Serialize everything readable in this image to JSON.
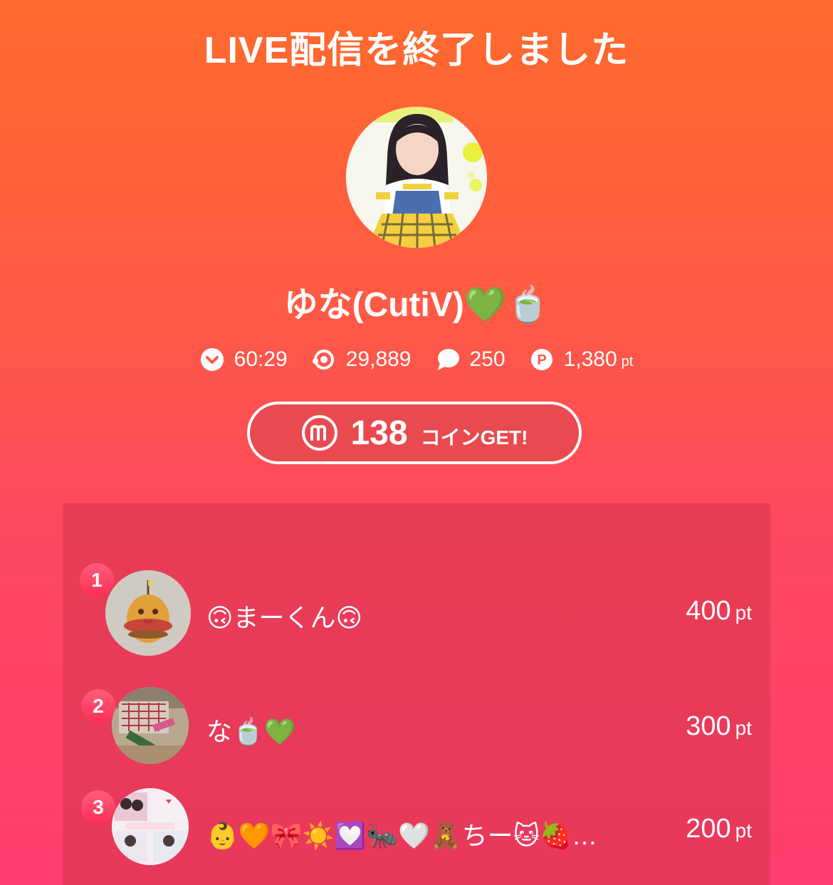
{
  "header": {
    "title": "LIVE配信を終了しました"
  },
  "streamer": {
    "name": "ゆな(CutiV)💚🍵"
  },
  "stats": {
    "duration": "60:29",
    "views": "29,889",
    "comments": "250",
    "points": "1,380",
    "points_unit": "pt"
  },
  "coins": {
    "amount": "138",
    "label": "コインGET!"
  },
  "ranking": [
    {
      "rank": "1",
      "name": "🙃まーくん🙃",
      "points": "400",
      "unit": "pt"
    },
    {
      "rank": "2",
      "name": "な🍵💚",
      "points": "300",
      "unit": "pt"
    },
    {
      "rank": "3",
      "name": "👶🧡🎀☀️💟🐜🤍🧸ちー🐱🍓…",
      "points": "200",
      "unit": "pt"
    }
  ],
  "icons": {
    "duration": "chevron-circle-icon",
    "views": "eye-ring-icon",
    "comments": "speech-bubble-icon",
    "points": "p-coin-icon",
    "coin": "m-coin-icon"
  },
  "colors": {
    "gradient_top": "#ff6a2c",
    "gradient_bottom": "#ff3d6e",
    "panel": "#d6344e",
    "coin_box": "#e84a50"
  }
}
